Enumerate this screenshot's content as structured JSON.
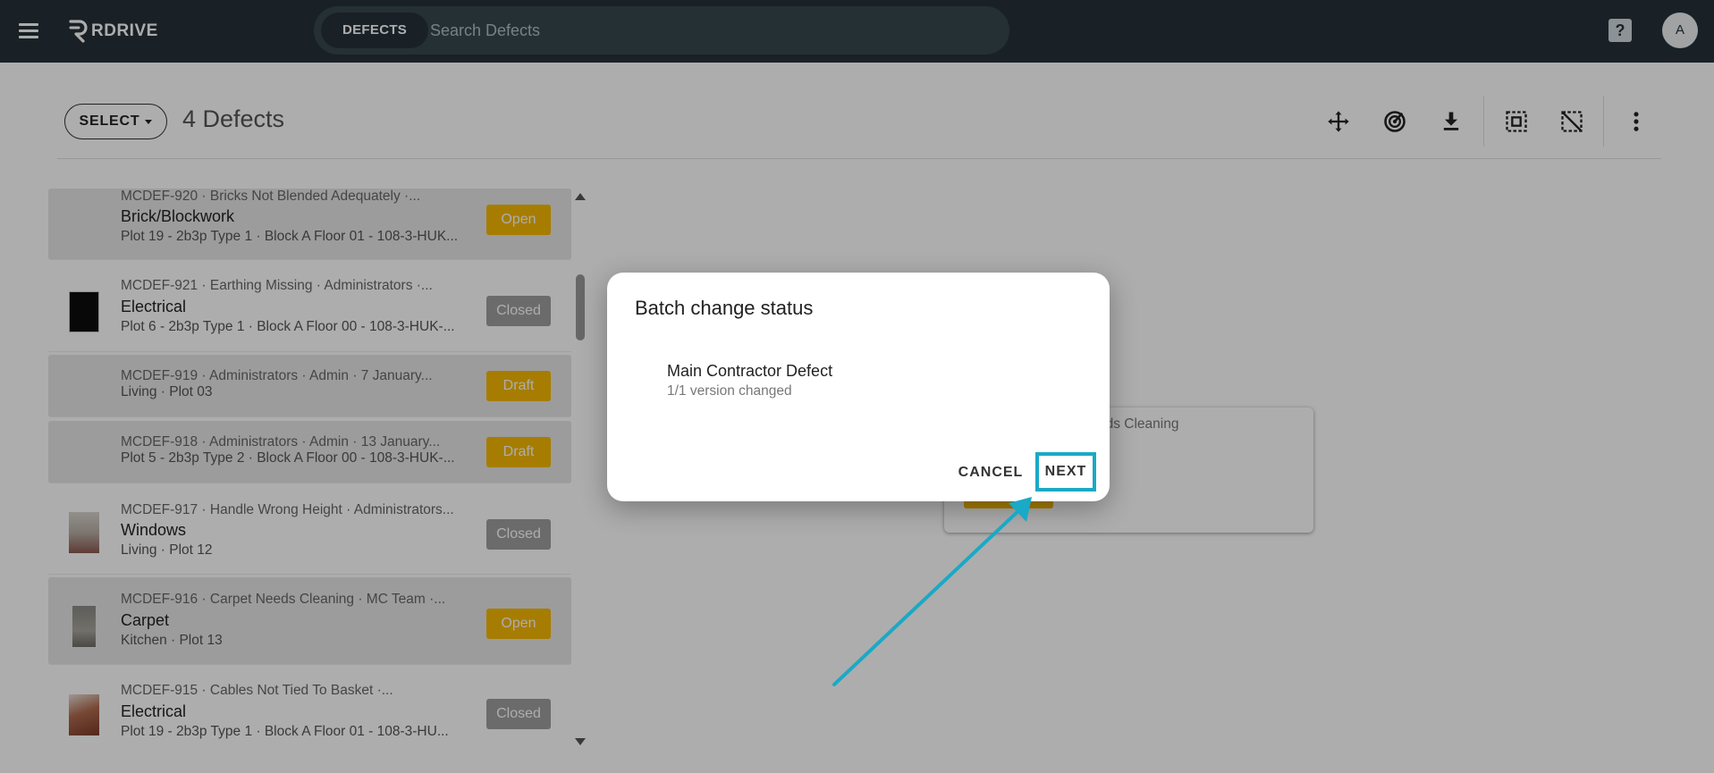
{
  "header": {
    "logo_text": "RDRIVE",
    "search_chip": "DEFECTS",
    "search_placeholder": "Search Defects",
    "help_label": "?",
    "avatar_initial": "A"
  },
  "toolbar": {
    "select_label": "SELECT",
    "count_title": "4 Defects",
    "tools": [
      "move-icon",
      "radar-icon",
      "download-icon",
      "select-all-icon",
      "deselect-all-icon",
      "more-vert-icon"
    ]
  },
  "defects": [
    {
      "meta": "MCDEF-920 · Bricks Not Blended Adequately ·...",
      "title": "Brick/Blockwork",
      "sub": "Plot 19 - 2b3p Type 1 · Block A Floor 01 - 108-3-HUK...",
      "status": "Open",
      "selected": true,
      "thumb": "none"
    },
    {
      "meta": "MCDEF-921 · Earthing Missing · Administrators ·...",
      "title": "Electrical",
      "sub": "Plot 6 - 2b3p Type 1 · Block A Floor 00 - 108-3-HUK-...",
      "status": "Closed",
      "selected": false,
      "thumb": "dark"
    },
    {
      "meta": "MCDEF-919 · Administrators · Admin · 7 January...",
      "title": "",
      "sub": "Living · Plot 03",
      "status": "Draft",
      "selected": true,
      "thumb": "none"
    },
    {
      "meta": "MCDEF-918 · Administrators · Admin · 13 January...",
      "title": "",
      "sub": "Plot 5 - 2b3p Type 2 · Block A Floor 00 - 108-3-HUK-...",
      "status": "Draft",
      "selected": true,
      "thumb": "none"
    },
    {
      "meta": "MCDEF-917 · Handle Wrong Height · Administrators...",
      "title": "Windows",
      "sub": "Living · Plot 12",
      "status": "Closed",
      "selected": false,
      "thumb": "window"
    },
    {
      "meta": "MCDEF-916 · Carpet Needs Cleaning · MC Team ·...",
      "title": "Carpet",
      "sub": "Kitchen · Plot 13",
      "status": "Open",
      "selected": true,
      "thumb": "carpet"
    },
    {
      "meta": "MCDEF-915 · Cables Not Tied To Basket ·...",
      "title": "Electrical",
      "sub": "Plot 19 - 2b3p Type 1 · Block A Floor 01 - 108-3-HU...",
      "status": "Closed",
      "selected": false,
      "thumb": "cables"
    }
  ],
  "background_card": {
    "meta_fragment": "eds Cleaning"
  },
  "dialog": {
    "title": "Batch change status",
    "item_name": "Main Contractor Defect",
    "item_sub": "1/1 version changed",
    "cancel_label": "CANCEL",
    "next_label": "NEXT"
  },
  "colors": {
    "topbar": "#263238",
    "open_badge": "#f5b800",
    "closed_badge": "#9e9e9e",
    "highlight": "#1aa9c6"
  }
}
